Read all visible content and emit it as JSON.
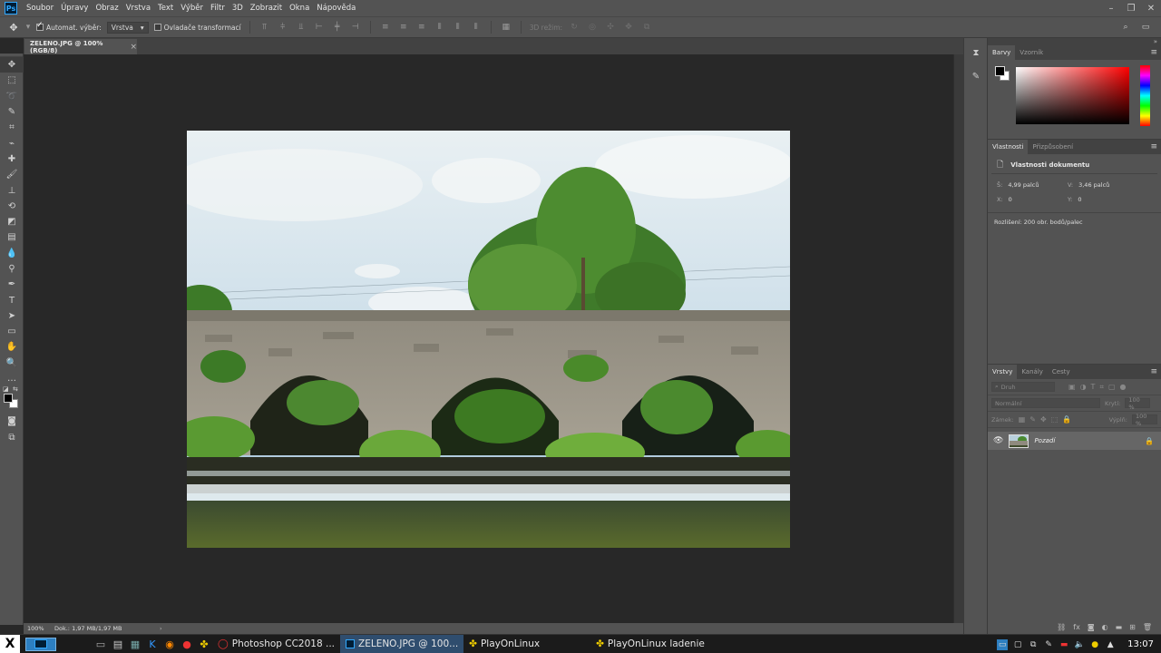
{
  "app": {
    "icon_text": "Ps"
  },
  "menu": [
    "Soubor",
    "Úpravy",
    "Obraz",
    "Vrstva",
    "Text",
    "Výběr",
    "Filtr",
    "3D",
    "Zobrazit",
    "Okna",
    "Nápověda"
  ],
  "options": {
    "auto_select_label": "Automat. výběr:",
    "auto_select_value": "Vrstva",
    "transform_label": "Ovladače transformací",
    "mode_3d_label": "3D režim:"
  },
  "document": {
    "tab_title": "ZELENO.JPG @ 100% (RGB/8)",
    "zoom": "100%",
    "doc_size": "Dok.: 1,97 MB/1,97 MB"
  },
  "panels": {
    "color_tabs": [
      "Barvy",
      "Vzorník"
    ],
    "props_tabs": [
      "Vlastnosti",
      "Přizpůsobení"
    ],
    "props_title": "Vlastnosti dokumentu",
    "width_label": "Š:",
    "width_value": "4,99 palců",
    "height_label": "V:",
    "height_value": "3,46 palců",
    "x_label": "X:",
    "x_value": "0",
    "y_label": "Y:",
    "y_value": "0",
    "resolution": "Rozlišení: 200 obr. bodů/palec",
    "layers_tabs": [
      "Vrstvy",
      "Kanály",
      "Cesty"
    ],
    "layer_filter": "Druh",
    "blend_mode": "Normální",
    "opacity_label": "Krytí:",
    "opacity_value": "100 %",
    "lock_label": "Zámek:",
    "fill_label": "Výplň:",
    "fill_value": "100 %",
    "layer_name": "Pozadí"
  },
  "taskbar": {
    "tasks": [
      {
        "label": "Photoshop CC2018 ..."
      },
      {
        "label": "ZELENO.JPG @ 100..."
      },
      {
        "label": "PlayOnLinux"
      },
      {
        "label": "PlayOnLinux ladenie"
      }
    ],
    "clock": "13:07"
  },
  "colors": {
    "accent": "#31a8ff",
    "ui_bg": "#535353",
    "canvas_bg": "#282828"
  }
}
